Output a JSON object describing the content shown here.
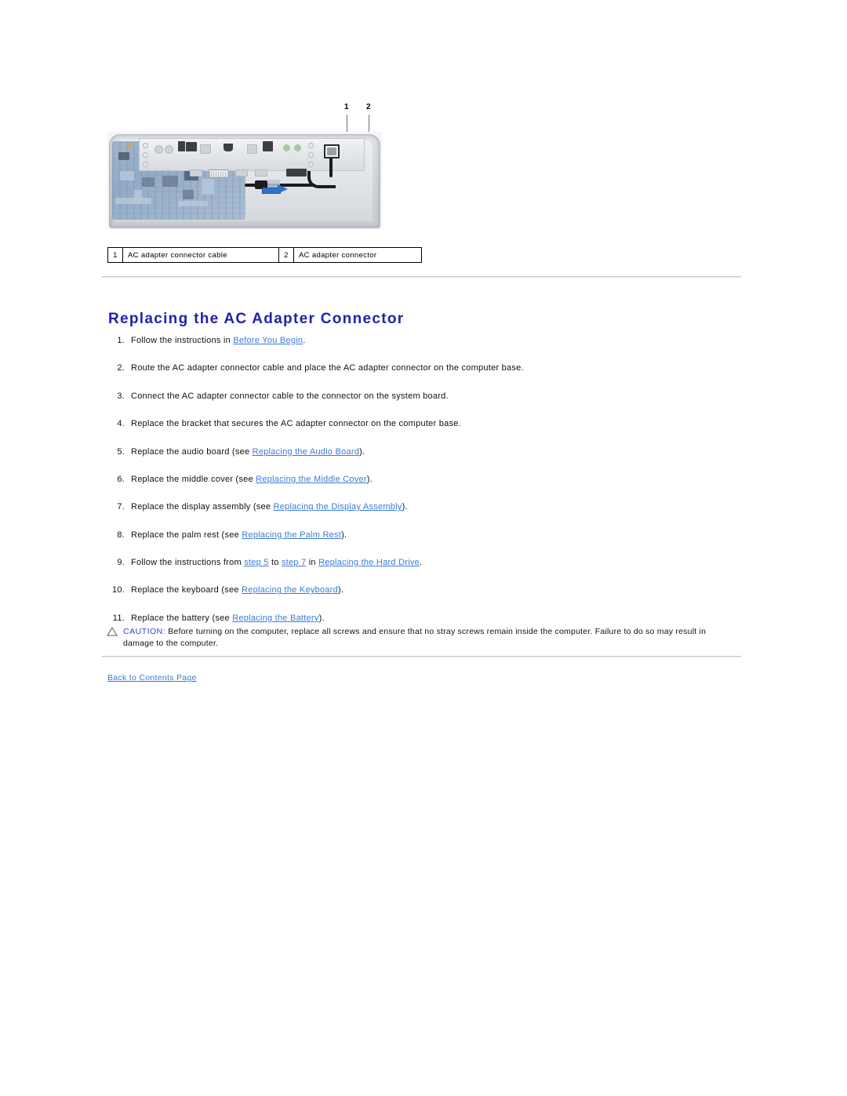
{
  "document": {
    "title": "Replacing the AC Adapter Connector"
  },
  "figure": {
    "callouts": [
      {
        "number": "1"
      },
      {
        "number": "2"
      }
    ],
    "caption_table": {
      "rows": [
        {
          "num_a": "1",
          "label_a": "AC adapter connector cable",
          "num_b": "2",
          "label_b": "AC adapter connector"
        }
      ]
    }
  },
  "heading": "Replacing the AC Adapter Connector",
  "steps": [
    {
      "num": "1.",
      "segments": [
        {
          "type": "text",
          "text": "Follow the instructions in "
        },
        {
          "type": "link",
          "text": "Before You Begin"
        },
        {
          "type": "text",
          "text": "."
        }
      ]
    },
    {
      "num": "2.",
      "segments": [
        {
          "type": "text",
          "text": "Route the AC adapter connector cable and place the AC adapter connector on the computer base."
        }
      ]
    },
    {
      "num": "3.",
      "segments": [
        {
          "type": "text",
          "text": "Connect the AC adapter connector cable to the connector on the system board."
        }
      ]
    },
    {
      "num": "4.",
      "segments": [
        {
          "type": "text",
          "text": "Replace the bracket that secures the AC adapter connector on the computer base."
        }
      ]
    },
    {
      "num": "5.",
      "segments": [
        {
          "type": "text",
          "text": "Replace the audio board (see "
        },
        {
          "type": "link",
          "text": "Replacing the Audio Board"
        },
        {
          "type": "text",
          "text": ")."
        }
      ]
    },
    {
      "num": "6.",
      "segments": [
        {
          "type": "text",
          "text": "Replace the middle cover (see "
        },
        {
          "type": "link",
          "text": "Replacing the Middle Cover"
        },
        {
          "type": "text",
          "text": ")."
        }
      ]
    },
    {
      "num": "7.",
      "segments": [
        {
          "type": "text",
          "text": "Replace the display assembly (see "
        },
        {
          "type": "link",
          "text": "Replacing the Display Assembly"
        },
        {
          "type": "text",
          "text": ")."
        }
      ]
    },
    {
      "num": "8.",
      "segments": [
        {
          "type": "text",
          "text": "Replace the palm rest (see "
        },
        {
          "type": "link",
          "text": "Replacing the Palm Rest"
        },
        {
          "type": "text",
          "text": ")."
        }
      ]
    },
    {
      "num": "9.",
      "segments": [
        {
          "type": "text",
          "text": "Follow the instructions from "
        },
        {
          "type": "link",
          "text": "step 5"
        },
        {
          "type": "text",
          "text": " to "
        },
        {
          "type": "link",
          "text": "step 7"
        },
        {
          "type": "text",
          "text": " in "
        },
        {
          "type": "link",
          "text": "Replacing the Hard Drive"
        },
        {
          "type": "text",
          "text": "."
        }
      ]
    },
    {
      "num": "10.",
      "segments": [
        {
          "type": "text",
          "text": "Replace the keyboard (see "
        },
        {
          "type": "link",
          "text": "Replacing the Keyboard"
        },
        {
          "type": "text",
          "text": ")."
        }
      ]
    },
    {
      "num": "11.",
      "segments": [
        {
          "type": "text",
          "text": "Replace the battery (see "
        },
        {
          "type": "link",
          "text": "Replacing the Battery"
        },
        {
          "type": "text",
          "text": ")."
        }
      ]
    }
  ],
  "caution": {
    "icon": "warning-triangle-icon",
    "label": "CAUTION:",
    "text": " Before turning on the computer, replace all screws and ensure that no stray screws remain inside the computer. Failure to do so may result in damage to the computer."
  },
  "footer": {
    "back_link": "Back to Contents Page"
  },
  "colors": {
    "heading": "#2222AA",
    "link": "#3A7BD5",
    "caution_label": "#2A49C6",
    "rule": "#C8C8C8",
    "arrow": "#2F6FD0",
    "text": "#111111"
  }
}
